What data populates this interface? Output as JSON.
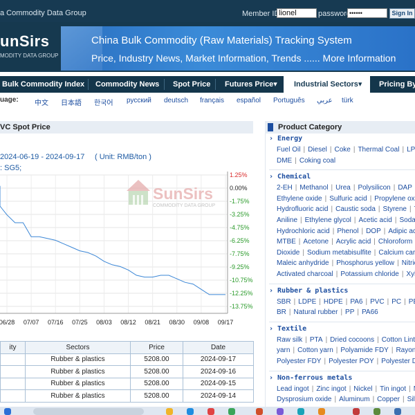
{
  "topbar": {
    "site_name": "a Commodity Data Group",
    "member_label": "Member ID",
    "member_value": "lionel",
    "password_label": "password",
    "password_value": "••••••",
    "signin_label": "Sign In"
  },
  "header": {
    "logo_main": "unSirs",
    "logo_sub": "MODITY DATA GROUP",
    "banner_title": "China Bulk Commodity (Raw Materials) Tracking System",
    "banner_sub": "Price, Industry News, Market Information, Trends ...... More Information"
  },
  "nav": {
    "items": [
      {
        "label": "Bulk Commodity Index"
      },
      {
        "label": "Commodity News"
      },
      {
        "label": "Spot Price"
      },
      {
        "label": "Futures Price▾"
      },
      {
        "label": "Industrial Sectors▾"
      },
      {
        "label": "Pricing By"
      }
    ]
  },
  "languages": {
    "label": "uage:",
    "items": [
      "中文",
      "日本語",
      "한국어",
      "русский",
      "deutsch",
      "français",
      "español",
      "Português",
      "عربي",
      "türk"
    ]
  },
  "left": {
    "panel_title": "VC Spot Price",
    "date_range": "2024-06-19 - 2024-09-17",
    "unit": "( Unit: RMB/ton )",
    "data_source": ": SG5;",
    "watermark_main": "SunSirs",
    "watermark_sub": "COMMODITY DATA GROUP"
  },
  "chart_data": {
    "type": "line",
    "x_ticks": [
      "06/28",
      "07/07",
      "07/16",
      "07/25",
      "08/03",
      "08/12",
      "08/21",
      "08/30",
      "09/08",
      "09/17"
    ],
    "y_ticks": [
      "1.25%",
      "0.00%",
      "-1.75%",
      "-3.25%",
      "-4.75%",
      "-6.25%",
      "-7.75%",
      "-9.25%",
      "-10.75%",
      "-12.25%",
      "-13.75%"
    ],
    "ylim": [
      -13.75,
      1.25
    ],
    "x": [
      "06/19",
      "06/22",
      "06/25",
      "06/28",
      "07/01",
      "07/04",
      "07/07",
      "07/10",
      "07/13",
      "07/16",
      "07/19",
      "07/22",
      "07/25",
      "07/28",
      "07/31",
      "08/03",
      "08/06",
      "08/09",
      "08/12",
      "08/15",
      "08/18",
      "08/21",
      "08/24",
      "08/27",
      "08/30",
      "09/02",
      "09/05",
      "09/08",
      "09/11",
      "09/14",
      "09/17"
    ],
    "values": [
      0.0,
      -0.5,
      -2.3,
      -3.3,
      -4.2,
      -4.2,
      -5.8,
      -5.8,
      -6.0,
      -6.2,
      -6.6,
      -7.0,
      -7.4,
      -7.6,
      -8.0,
      -8.6,
      -9.0,
      -9.2,
      -9.6,
      -10.2,
      -10.4,
      -10.4,
      -10.2,
      -10.2,
      -10.6,
      -11.0,
      -11.2,
      -11.8,
      -12.4,
      -12.4,
      -12.4
    ]
  },
  "table": {
    "headers": [
      "ity",
      "Sectors",
      "Price",
      "Date"
    ],
    "rows": [
      [
        "",
        "Rubber & plastics",
        "5208.00",
        "2024-09-17"
      ],
      [
        "",
        "Rubber & plastics",
        "5208.00",
        "2024-09-16"
      ],
      [
        "",
        "Rubber & plastics",
        "5208.00",
        "2024-09-15"
      ],
      [
        "",
        "Rubber & plastics",
        "5208.00",
        "2024-09-14"
      ]
    ]
  },
  "right": {
    "title": "Product Category",
    "categories": [
      {
        "title": "Energy",
        "lines": [
          [
            "Fuel Oil",
            "Diesel",
            "Coke",
            "Thermal Coal",
            "LPG"
          ],
          [
            "DME",
            "Coking coal"
          ]
        ]
      },
      {
        "title": "Chemical",
        "lines": [
          [
            "2-EH",
            "Methanol",
            "Urea",
            "Polysilicon",
            "DAP"
          ],
          [
            "Ethylene oxide",
            "Sulfuric acid",
            "Propylene oxide"
          ],
          [
            "Hydrofluoric acid",
            "Caustic soda",
            "Styrene",
            "To"
          ],
          [
            "Aniline",
            "Ethylene glycol",
            "Acetic acid",
            "Soda a"
          ],
          [
            "Hydrochloric acid",
            "Phenol",
            "DOP",
            "Adipic aci"
          ],
          [
            "MTBE",
            "Acetone",
            "Acrylic acid",
            "Chloroform"
          ],
          [
            "Dioxide",
            "Sodium metabisulfite",
            "Calcium carbi"
          ],
          [
            "Maleic anhydride",
            "Phosphorus yellow",
            "Nitric a"
          ],
          [
            "Activated charcoal",
            "Potassium chloride",
            "Xyle"
          ]
        ]
      },
      {
        "title": "Rubber & plastics",
        "lines": [
          [
            "SBR",
            "LDPE",
            "HDPE",
            "PA6",
            "PVC",
            "PC",
            "PET"
          ],
          [
            "BR",
            "Natural rubber",
            "PP",
            "PA66"
          ]
        ]
      },
      {
        "title": "Textile",
        "lines": [
          [
            "Raw silk",
            "PTA",
            "Dried cocoons",
            "Cotton Lint"
          ],
          [
            "yarn",
            "Cotton yarn",
            "Polyamide FDY",
            "Rayon ya"
          ],
          [
            "Polyester FDY",
            "Polyester POY",
            "Polyester DT"
          ]
        ]
      },
      {
        "title": "Non-ferrous metals",
        "lines": [
          [
            "Lead ingot",
            "Zinc ingot",
            "Nickel",
            "Tin ingot",
            "Me"
          ],
          [
            "Dysprosium oxide",
            "Aluminum",
            "Copper",
            "Silve"
          ]
        ]
      }
    ]
  },
  "colors": {
    "nav_bg": "#14364b",
    "header_bg": "#16394f",
    "link_blue": "#1d4ea0",
    "chart_line": "#3a86d6",
    "axis_green": "#2a9a2a",
    "axis_red": "#d92b2b"
  }
}
